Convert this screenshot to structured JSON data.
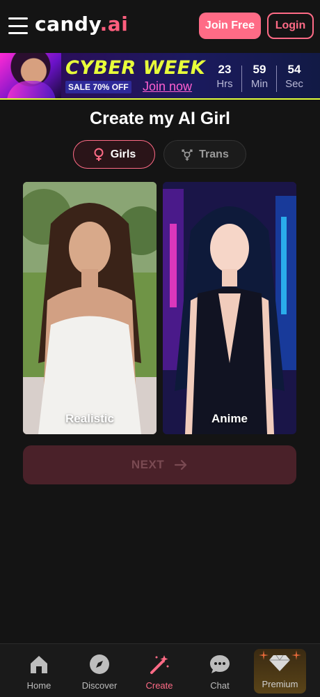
{
  "header": {
    "logo_main": "candy",
    "logo_dot": ".",
    "logo_tld": "ai",
    "join_label": "Join Free",
    "login_label": "Login"
  },
  "banner": {
    "headline": "CYBER WEEK",
    "sale": "SALE 70% OFF",
    "cta": "Join now",
    "countdown": [
      {
        "value": "23",
        "unit": "Hrs"
      },
      {
        "value": "59",
        "unit": "Min"
      },
      {
        "value": "54",
        "unit": "Sec"
      }
    ]
  },
  "page_title": "Create my AI Girl",
  "tabs": [
    {
      "label": "Girls",
      "icon": "female-icon",
      "selected": true
    },
    {
      "label": "Trans",
      "icon": "transgender-icon",
      "selected": false
    }
  ],
  "styles": [
    {
      "label": "Realistic"
    },
    {
      "label": "Anime"
    }
  ],
  "next_label": "NEXT",
  "bottom_nav": [
    {
      "label": "Home",
      "icon": "home-icon"
    },
    {
      "label": "Discover",
      "icon": "compass-icon"
    },
    {
      "label": "Create",
      "icon": "magic-wand-icon",
      "active": true
    },
    {
      "label": "Chat",
      "icon": "chat-bubble-icon"
    },
    {
      "label": "Premium",
      "icon": "diamond-icon"
    }
  ],
  "colors": {
    "accent": "#ff6b86",
    "background": "#141414",
    "banner_highlight": "#e8ff3a"
  }
}
